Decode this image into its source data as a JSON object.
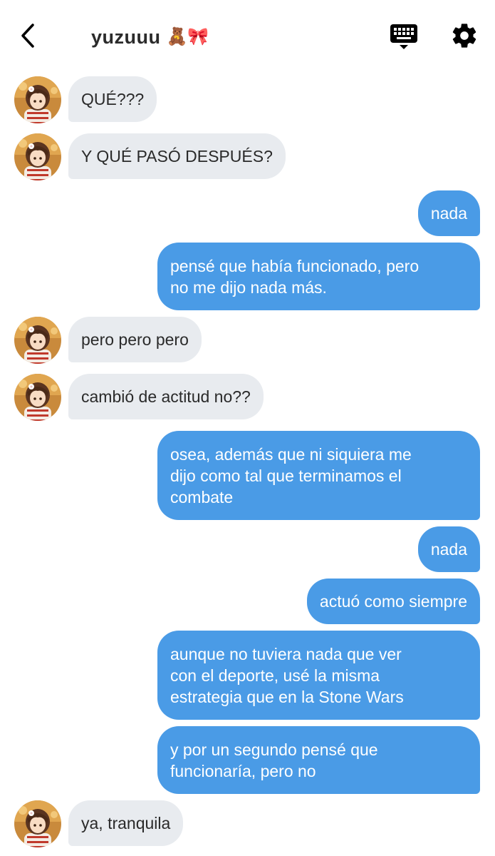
{
  "header": {
    "contact_name": "yuzuuu",
    "contact_emoji": "🧸🎀"
  },
  "messages": [
    {
      "side": "in",
      "text": "QUÉ???"
    },
    {
      "side": "in",
      "text": "Y QUÉ PASÓ DESPUÉS?"
    },
    {
      "side": "out",
      "text": "nada"
    },
    {
      "side": "out",
      "text": "pensé que había funcionado, pero\nno me dijo nada más."
    },
    {
      "side": "in",
      "text": "pero pero pero"
    },
    {
      "side": "in",
      "text": "cambió de actitud no??"
    },
    {
      "side": "out",
      "text": "osea, además que ni siquiera me\ndijo como tal que terminamos el\ncombate"
    },
    {
      "side": "out",
      "text": "nada"
    },
    {
      "side": "out",
      "text": "actuó como siempre"
    },
    {
      "side": "out",
      "text": "aunque no tuviera nada que ver\ncon el deporte, usé la misma\nestrategia que en la Stone Wars"
    },
    {
      "side": "out",
      "text": "y por un segundo pensé que\nfuncionaría, pero no"
    },
    {
      "side": "in",
      "text": "ya, tranquila"
    }
  ],
  "colors": {
    "outgoing_bubble": "#4a9be6",
    "incoming_bubble": "#e8ebef",
    "icon": "#000000"
  },
  "icons": {
    "back": "chevron-left-icon",
    "keyboard": "keyboard-icon",
    "settings": "gear-icon"
  }
}
